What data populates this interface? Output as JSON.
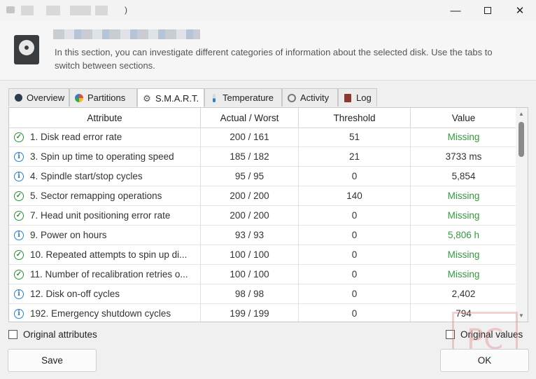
{
  "window": {
    "title_suffix": ")",
    "minimize_icon": "minimize-icon",
    "maximize_icon": "maximize-icon",
    "close_icon": "close-icon"
  },
  "header": {
    "icon": "hard-disk-icon",
    "description": "In this section, you can investigate different categories of information about the selected disk. Use the tabs to switch between sections."
  },
  "tabs": [
    {
      "label": "Overview",
      "icon": "disk-overview-icon"
    },
    {
      "label": "Partitions",
      "icon": "pie-chart-icon"
    },
    {
      "label": "S.M.A.R.T.",
      "icon": "gear-icon",
      "active": true
    },
    {
      "label": "Temperature",
      "icon": "thermometer-icon"
    },
    {
      "label": "Activity",
      "icon": "gauge-icon"
    },
    {
      "label": "Log",
      "icon": "log-book-icon"
    }
  ],
  "table": {
    "columns": [
      "Attribute",
      "Actual / Worst",
      "Threshold",
      "Value"
    ],
    "rows": [
      {
        "status": "ok",
        "attribute": "1. Disk read error rate",
        "actual_worst": "200 / 161",
        "threshold": "51",
        "value": "Missing",
        "value_color": "green"
      },
      {
        "status": "info",
        "attribute": "3. Spin up time to operating speed",
        "actual_worst": "185 / 182",
        "threshold": "21",
        "value": "3733 ms",
        "value_color": "normal"
      },
      {
        "status": "info",
        "attribute": "4. Spindle start/stop cycles",
        "actual_worst": "95 / 95",
        "threshold": "0",
        "value": "5,854",
        "value_color": "normal"
      },
      {
        "status": "ok",
        "attribute": "5. Sector remapping operations",
        "actual_worst": "200 / 200",
        "threshold": "140",
        "value": "Missing",
        "value_color": "green"
      },
      {
        "status": "ok",
        "attribute": "7. Head unit positioning error rate",
        "actual_worst": "200 / 200",
        "threshold": "0",
        "value": "Missing",
        "value_color": "green"
      },
      {
        "status": "info",
        "attribute": "9. Power on hours",
        "actual_worst": "93 / 93",
        "threshold": "0",
        "value": "5,806 h",
        "value_color": "green"
      },
      {
        "status": "ok",
        "attribute": "10. Repeated attempts to spin up di...",
        "actual_worst": "100 / 100",
        "threshold": "0",
        "value": "Missing",
        "value_color": "green"
      },
      {
        "status": "ok",
        "attribute": "11. Number of recalibration retries o...",
        "actual_worst": "100 / 100",
        "threshold": "0",
        "value": "Missing",
        "value_color": "green"
      },
      {
        "status": "info",
        "attribute": "12. Disk on-off cycles",
        "actual_worst": "98 / 98",
        "threshold": "0",
        "value": "2,402",
        "value_color": "normal"
      },
      {
        "status": "info",
        "attribute": "192. Emergency shutdown cycles",
        "actual_worst": "199 / 199",
        "threshold": "0",
        "value": "794",
        "value_color": "normal"
      }
    ]
  },
  "options": {
    "original_attributes": "Original attributes",
    "original_values": "Original values"
  },
  "buttons": {
    "save": "Save",
    "ok": "OK"
  },
  "colors": {
    "ok_green": "#2c8d3c",
    "info_blue": "#2a7fc6",
    "value_green": "#2f9c3a"
  }
}
